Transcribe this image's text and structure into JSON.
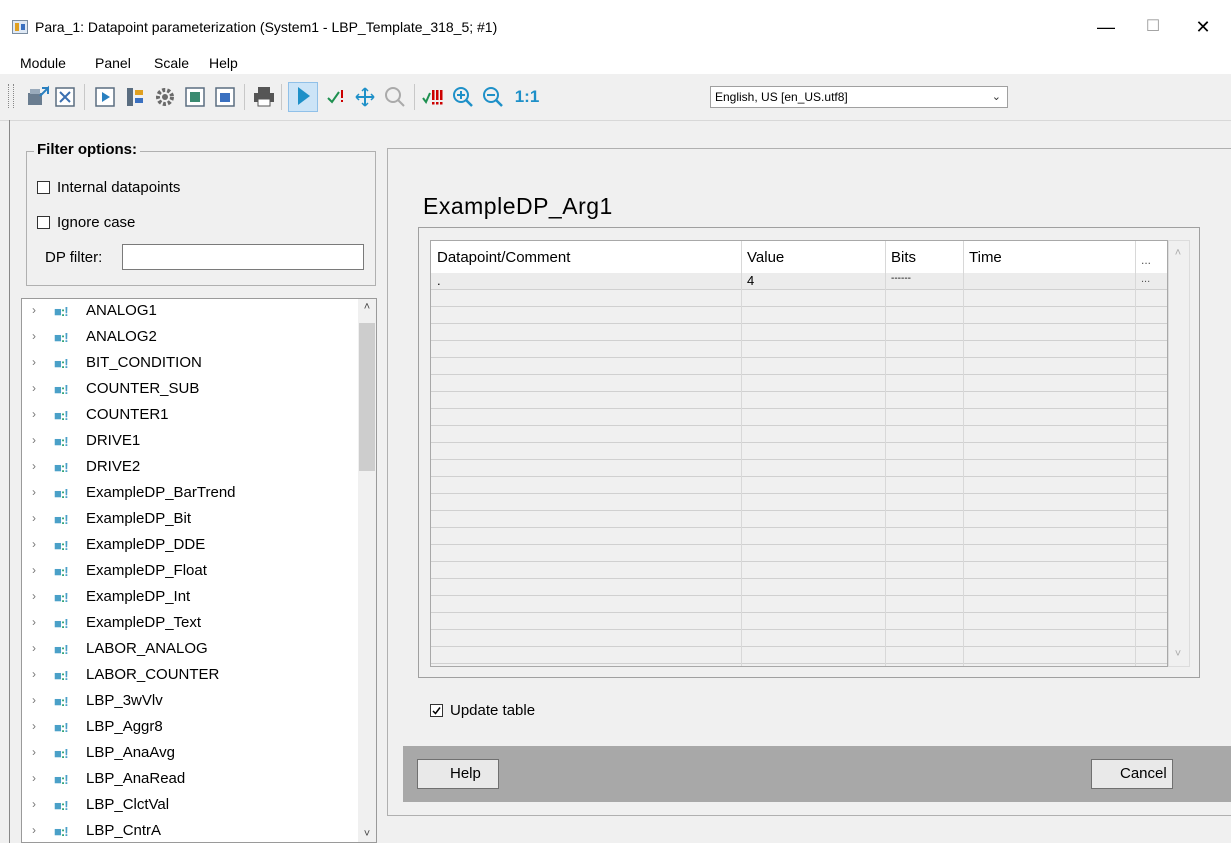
{
  "window": {
    "title": "Para_1: Datapoint parameterization (System1 - LBP_Template_318_5; #1)",
    "minimize": "—",
    "maximize": "☐",
    "close": "✕"
  },
  "menu": [
    "Module",
    "Panel",
    "Scale",
    "Help"
  ],
  "toolbar": {
    "buttons": [
      "import-icon",
      "close-panel-icon",
      "run-icon",
      "tree-icon",
      "settings-icon",
      "panel-icon",
      "panel-alt-icon",
      "print-icon",
      "pointer-icon",
      "check-icon",
      "move-icon",
      "search-icon",
      "errors-icon",
      "zoom-in-icon",
      "zoom-out-icon",
      "zoom-reset-icon"
    ],
    "zoom_reset_label": "1:1",
    "language": "English, US [en_US.utf8]"
  },
  "filter": {
    "title": "Filter options:",
    "internal_datapoints": "Internal datapoints",
    "ignore_case": "Ignore case",
    "dp_filter_label": "DP filter:",
    "dp_filter_value": ""
  },
  "tree": {
    "items": [
      "ANALOG1",
      "ANALOG2",
      "BIT_CONDITION",
      "COUNTER_SUB",
      "COUNTER1",
      "DRIVE1",
      "DRIVE2",
      "ExampleDP_BarTrend",
      "ExampleDP_Bit",
      "ExampleDP_DDE",
      "ExampleDP_Float",
      "ExampleDP_Int",
      "ExampleDP_Text",
      "LABOR_ANALOG",
      "LABOR_COUNTER",
      "LBP_3wVlv",
      "LBP_Aggr8",
      "LBP_AnaAvg",
      "LBP_AnaRead",
      "LBP_ClctVal",
      "LBP_CntrA"
    ]
  },
  "main": {
    "dp_name": "ExampleDP_Arg1",
    "table": {
      "headers": [
        "Datapoint/Comment",
        "Value",
        "Bits",
        "Time",
        "..."
      ],
      "rows": [
        [
          ".",
          "4",
          "------",
          "",
          "..."
        ]
      ]
    },
    "update_table": "Update table",
    "help_button": "Help",
    "cancel_button": "Cancel"
  },
  "colors": {
    "accent": "#1e90c8",
    "button_bar": "#a8a8a8",
    "check_red": "#cc0000"
  }
}
